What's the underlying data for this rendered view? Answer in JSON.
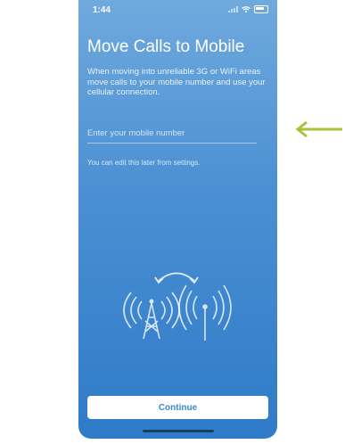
{
  "status_bar": {
    "time": "1:44"
  },
  "screen": {
    "title": "Move Calls to Mobile",
    "description": "When moving into unreliable 3G or WiFi areas move calls to your mobile number and use your cellular connection.",
    "mobile_input": {
      "value": "",
      "placeholder": "Enter your mobile number"
    },
    "helper_text": "You can edit this later from settings.",
    "continue_label": "Continue"
  },
  "colors": {
    "background_top": "#6fa9dd",
    "background_bottom": "#2f7bc8",
    "button_text": "#3d88cf",
    "pointer_arrow": "#a8c23a"
  },
  "icons": {
    "illustration": [
      "cell-tower-icon",
      "antenna-icon",
      "swap-arrows-icon"
    ],
    "pointer": "arrow-left-icon"
  }
}
